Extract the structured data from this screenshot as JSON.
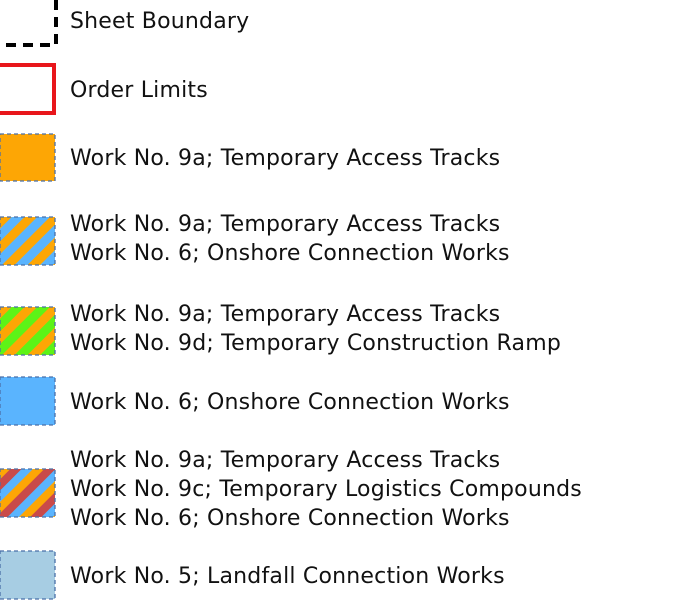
{
  "legend": {
    "items": [
      {
        "key": "sheet-boundary",
        "swatch": "dashed-outline",
        "colors": [
          "#000000"
        ],
        "lines": [
          "Sheet Boundary"
        ]
      },
      {
        "key": "order-limits",
        "swatch": "solid-outline",
        "colors": [
          "#e8161b"
        ],
        "lines": [
          "Order Limits"
        ]
      },
      {
        "key": "work-9a",
        "swatch": "fill",
        "colors": [
          "#fda605"
        ],
        "lines": [
          "Work No. 9a; Temporary Access Tracks"
        ]
      },
      {
        "key": "work-9a-6",
        "swatch": "stripes",
        "colors": [
          "#fda605",
          "#5ab4fe"
        ],
        "lines": [
          "Work No. 9a; Temporary Access Tracks",
          "Work No. 6; Onshore Connection Works"
        ]
      },
      {
        "key": "work-9a-9d",
        "swatch": "stripes",
        "colors": [
          "#fda605",
          "#5df317"
        ],
        "lines": [
          "Work No. 9a; Temporary Access Tracks",
          "Work No. 9d; Temporary Construction Ramp"
        ]
      },
      {
        "key": "work-6",
        "swatch": "fill",
        "colors": [
          "#5ab4fe"
        ],
        "lines": [
          "Work No. 6; Onshore Connection Works"
        ]
      },
      {
        "key": "work-9a-9c-6",
        "swatch": "stripes",
        "colors": [
          "#fda605",
          "#c94a4a",
          "#5ab4fe"
        ],
        "lines": [
          "Work No. 9a; Temporary Access Tracks",
          "Work No. 9c; Temporary Logistics Compounds",
          "Work No. 6; Onshore Connection Works"
        ]
      },
      {
        "key": "work-5",
        "swatch": "fill",
        "colors": [
          "#a7cde3"
        ],
        "lines": [
          "Work No. 5; Landfall Connection Works"
        ]
      }
    ]
  }
}
